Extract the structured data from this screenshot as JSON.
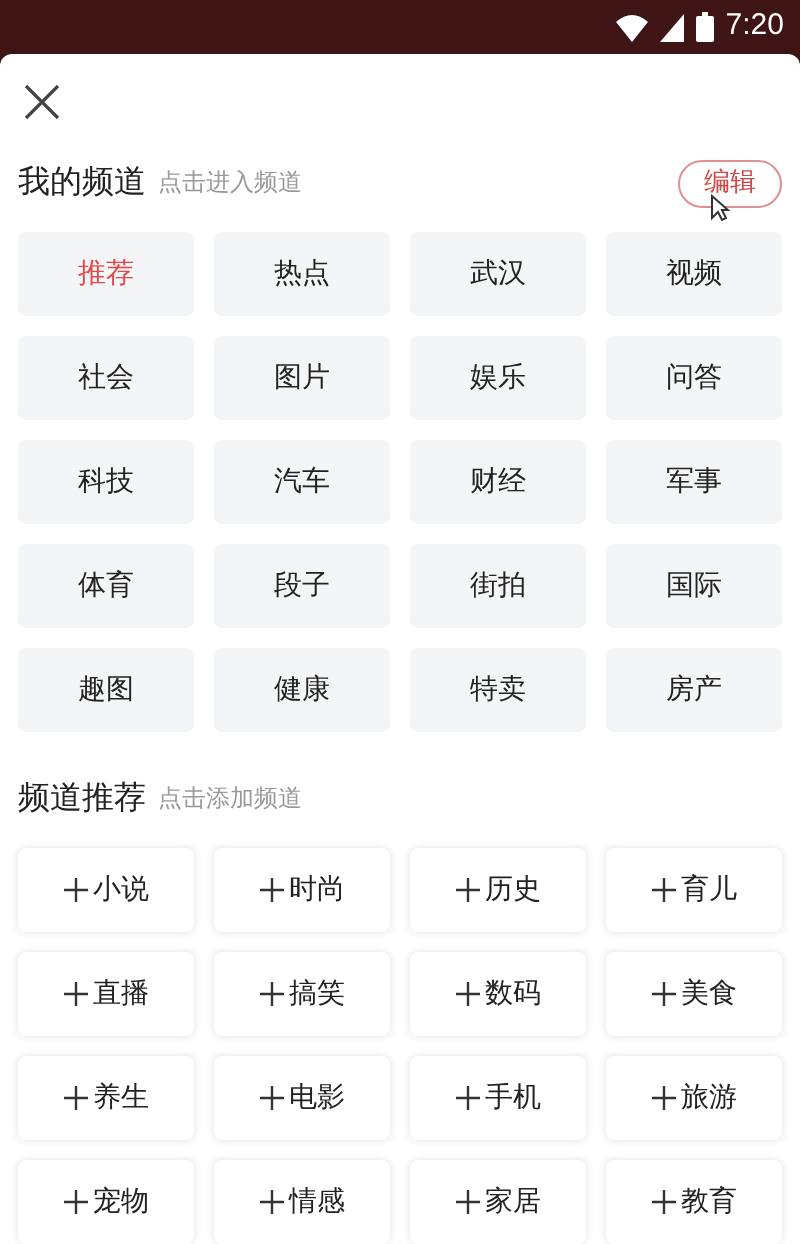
{
  "status_bar": {
    "time": "7:20"
  },
  "my_channels": {
    "title": "我的频道",
    "hint": "点击进入频道",
    "edit_button": "编辑",
    "items": [
      {
        "label": "推荐",
        "selected": true
      },
      {
        "label": "热点",
        "selected": false
      },
      {
        "label": "武汉",
        "selected": false
      },
      {
        "label": "视频",
        "selected": false
      },
      {
        "label": "社会",
        "selected": false
      },
      {
        "label": "图片",
        "selected": false
      },
      {
        "label": "娱乐",
        "selected": false
      },
      {
        "label": "问答",
        "selected": false
      },
      {
        "label": "科技",
        "selected": false
      },
      {
        "label": "汽车",
        "selected": false
      },
      {
        "label": "财经",
        "selected": false
      },
      {
        "label": "军事",
        "selected": false
      },
      {
        "label": "体育",
        "selected": false
      },
      {
        "label": "段子",
        "selected": false
      },
      {
        "label": "街拍",
        "selected": false
      },
      {
        "label": "国际",
        "selected": false
      },
      {
        "label": "趣图",
        "selected": false
      },
      {
        "label": "健康",
        "selected": false
      },
      {
        "label": "特卖",
        "selected": false
      },
      {
        "label": "房产",
        "selected": false
      }
    ]
  },
  "recommended_channels": {
    "title": "频道推荐",
    "hint": "点击添加频道",
    "items": [
      "小说",
      "时尚",
      "历史",
      "育儿",
      "直播",
      "搞笑",
      "数码",
      "美食",
      "养生",
      "电影",
      "手机",
      "旅游",
      "宠物",
      "情感",
      "家居",
      "教育"
    ]
  }
}
